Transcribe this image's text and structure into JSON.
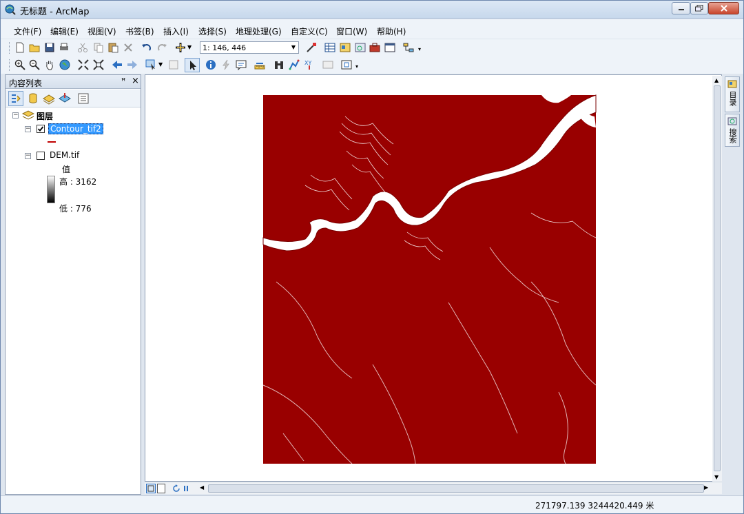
{
  "window": {
    "title": "无标题 - ArcMap"
  },
  "menu": [
    "文件(F)",
    "编辑(E)",
    "视图(V)",
    "书签(B)",
    "插入(I)",
    "选择(S)",
    "地理处理(G)",
    "自定义(C)",
    "窗口(W)",
    "帮助(H)"
  ],
  "toolbar": {
    "scale": "1: 146, 446"
  },
  "toc": {
    "title": "内容列表",
    "pin": "ꟸ",
    "close": "×",
    "root_label": "图层",
    "layers": [
      {
        "name": "Contour_tif2",
        "checked": true,
        "selected": true,
        "symbol_color": "#c00000"
      },
      {
        "name": "DEM.tif",
        "checked": false,
        "selected": false
      }
    ],
    "dem_legend": {
      "field": "值",
      "high": "高 : 3162",
      "low": "低 : 776"
    }
  },
  "map": {
    "fill_color": "#990000",
    "background": "#ffffff"
  },
  "right_dock": {
    "catalog": "目录",
    "search": "搜索"
  },
  "status": {
    "coordinates": "271797.139  3244420.449 米"
  }
}
